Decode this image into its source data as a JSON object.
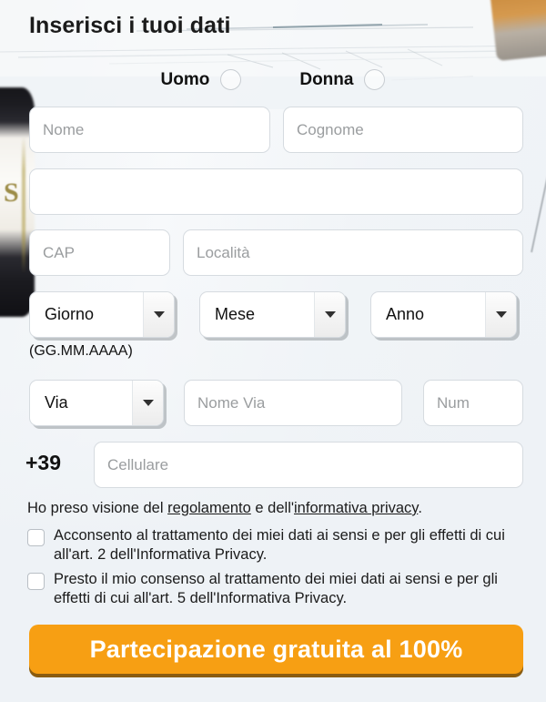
{
  "page": {
    "title": "Inserisci i tuoi dati",
    "background_color": "#eef2f6",
    "accent_color": "#f79f13"
  },
  "gender": {
    "options": [
      {
        "label": "Uomo",
        "selected": false
      },
      {
        "label": "Donna",
        "selected": false
      }
    ]
  },
  "fields": {
    "nome": {
      "placeholder": "Nome",
      "value": ""
    },
    "cognome": {
      "placeholder": "Cognome",
      "value": ""
    },
    "email": {
      "placeholder": "",
      "value": ""
    },
    "cap": {
      "placeholder": "CAP",
      "value": ""
    },
    "localita": {
      "placeholder": "Località",
      "value": ""
    },
    "nome_via": {
      "placeholder": "Nome Via",
      "value": ""
    },
    "num": {
      "placeholder": "Num",
      "value": ""
    },
    "cellulare": {
      "placeholder": "Cellulare",
      "value": ""
    }
  },
  "selects": {
    "giorno": {
      "value": "Giorno"
    },
    "mese": {
      "value": "Mese"
    },
    "anno": {
      "value": "Anno"
    },
    "via": {
      "value": "Via"
    }
  },
  "date_hint": "(GG.MM.AAAA)",
  "phone_prefix": "+39",
  "consent": {
    "intro_prefix": "Ho preso visione del ",
    "link_regolamento": "regolamento",
    "intro_middle": " e dell'",
    "link_privacy": "informativa privacy",
    "intro_suffix": ".",
    "checkbox_1": {
      "text": "Acconsento al trattamento dei miei dati ai sensi e per gli effetti di cui all'art. 2 dell'Informativa Privacy.",
      "checked": false
    },
    "checkbox_2": {
      "text": "Presto il mio consenso al trattamento dei miei dati ai sensi e per gli effetti di cui all'art. 5 dell'Informativa Privacy.",
      "checked": false
    }
  },
  "submit": {
    "label": "Partecipazione gratuita al 100%"
  }
}
